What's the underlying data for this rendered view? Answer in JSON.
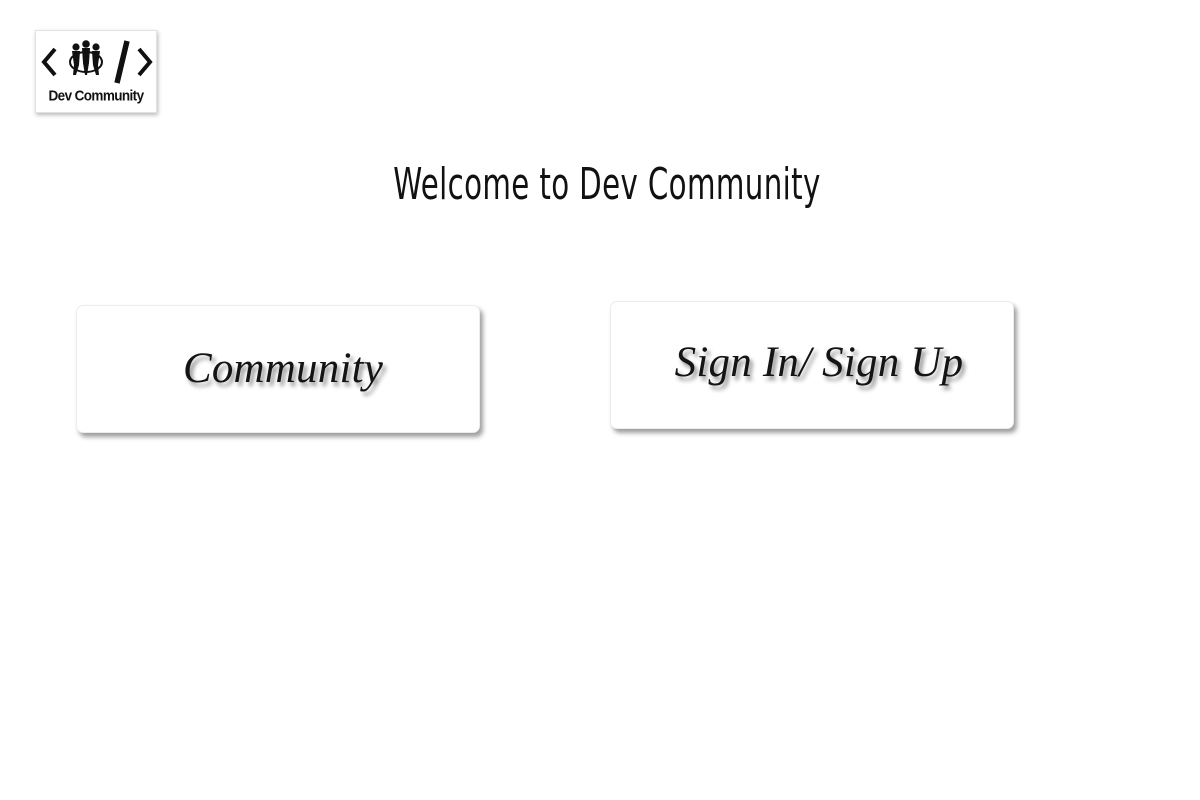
{
  "logo": {
    "text": "Dev Community",
    "icon": "code-brackets-people-icon"
  },
  "page": {
    "title": "Welcome to Dev Community"
  },
  "nav": {
    "community_label": "Community",
    "signin_label": "Sign In/ Sign Up"
  }
}
